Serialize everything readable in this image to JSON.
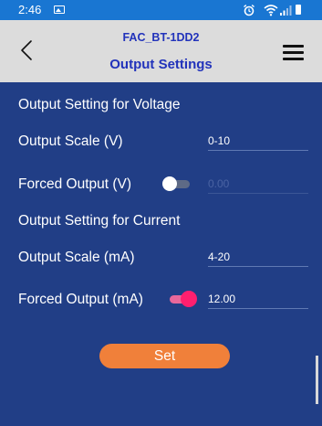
{
  "status_bar": {
    "time": "2:46",
    "icons": [
      "gallery-icon",
      "alarm-icon",
      "wifi-icon",
      "signal-icon",
      "battery-icon"
    ],
    "color": "#1976d2"
  },
  "header": {
    "device_name": "FAC_BT-1DD2",
    "title": "Output Settings",
    "back_icon": "chevron-left-icon",
    "menu_icon": "hamburger-menu-icon",
    "background": "#dcdcdc",
    "title_color": "#2233bb"
  },
  "voltage": {
    "section_title": "Output Setting for Voltage",
    "scale_label": "Output Scale (V)",
    "scale_value": "0-10",
    "forced_label": "Forced Output (V)",
    "forced_enabled": false,
    "forced_value": "0.00"
  },
  "current": {
    "section_title": "Output Setting for Current",
    "scale_label": "Output Scale (mA)",
    "scale_value": "4-20",
    "forced_label": "Forced Output (mA)",
    "forced_enabled": true,
    "forced_value": "12.00"
  },
  "set_button": {
    "label": "Set",
    "color": "#f0803a"
  },
  "colors": {
    "background": "#213e86",
    "switch_on": "#ff1f6f"
  }
}
